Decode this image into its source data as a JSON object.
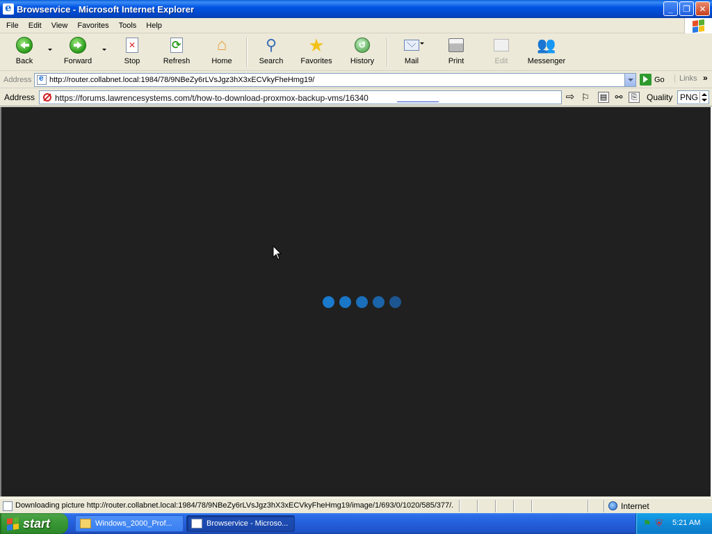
{
  "window": {
    "title": "Browservice - Microsoft Internet Explorer"
  },
  "menu": {
    "items": [
      "File",
      "Edit",
      "View",
      "Favorites",
      "Tools",
      "Help"
    ]
  },
  "toolbar": {
    "back": "Back",
    "forward": "Forward",
    "stop": "Stop",
    "refresh": "Refresh",
    "home": "Home",
    "search": "Search",
    "favorites": "Favorites",
    "history": "History",
    "mail": "Mail",
    "print": "Print",
    "edit": "Edit",
    "messenger": "Messenger"
  },
  "address_bar": {
    "label": "Address",
    "url": "http://router.collabnet.local:1984/78/9NBeZy6rLVsJgz3hX3xECVkyFheHmg19/",
    "go": "Go",
    "links": "Links"
  },
  "inner_address_bar": {
    "label": "Address",
    "url": "https://forums.lawrencesystems.com/t/how-to-download-proxmox-backup-vms/16340",
    "quality_label": "Quality",
    "quality_value": "PNG"
  },
  "viewport": {
    "background": "#202020",
    "spinner_colors": [
      "#1a7acc",
      "#1a76c6",
      "#1a6fba",
      "#1b64a8",
      "#1d5590"
    ]
  },
  "status_bar": {
    "text": "Downloading picture http://router.collabnet.local:1984/78/9NBeZy6rLVsJgz3hX3xECVkyFheHmg19/image/1/693/0/1020/585/377/...",
    "zone": "Internet"
  },
  "taskbar": {
    "start": "start",
    "tasks": [
      "Windows_2000_Prof...",
      "Browservice - Microso..."
    ],
    "clock": "5:21 AM"
  },
  "colors": {
    "title_blue": "#0054e3",
    "taskbar_blue": "#245edb",
    "start_green": "#3c9a37"
  }
}
